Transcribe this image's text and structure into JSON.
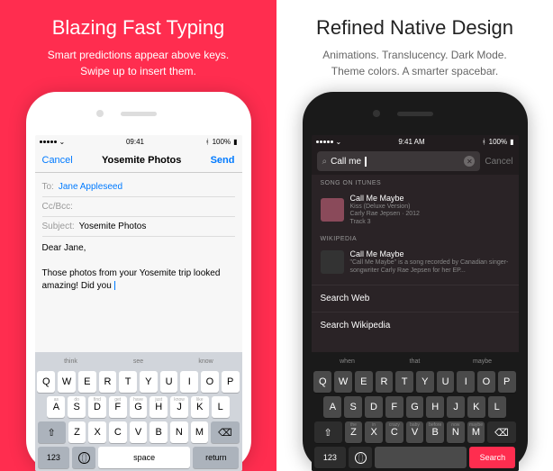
{
  "left": {
    "headline": "Blazing Fast Typing",
    "sub1": "Smart predictions appear above keys.",
    "sub2": "Swipe up to insert them.",
    "statusbar": {
      "carrier": "",
      "time": "09:41",
      "battery": "100%"
    },
    "nav": {
      "cancel": "Cancel",
      "title": "Yosemite Photos",
      "send": "Send"
    },
    "compose": {
      "to_label": "To:",
      "to_value": "Jane Appleseed",
      "cc_label": "Cc/Bcc:",
      "subject_label": "Subject:",
      "subject_value": "Yosemite Photos",
      "greeting": "Dear Jane,",
      "body": "Those photos from your Yosemite trip looked amazing! Did you "
    },
    "predictions": [
      "think",
      "see",
      "know"
    ],
    "hints_row2": [
      "as",
      "do",
      "find",
      "get",
      "have",
      "just",
      "know",
      "like"
    ],
    "keys": {
      "row1": [
        "Q",
        "W",
        "E",
        "R",
        "T",
        "Y",
        "U",
        "I",
        "O",
        "P"
      ],
      "row2": [
        "A",
        "S",
        "D",
        "F",
        "G",
        "H",
        "J",
        "K",
        "L"
      ],
      "row3": [
        "Z",
        "X",
        "C",
        "V",
        "B",
        "N",
        "M"
      ],
      "shift": "⇧",
      "backspace": "⌫",
      "numbers": "123",
      "space": "space",
      "return": "return"
    }
  },
  "right": {
    "headline": "Refined Native Design",
    "sub1": "Animations. Translucency. Dark Mode.",
    "sub2": "Theme colors. A smarter spacebar.",
    "statusbar": {
      "time": "9:41 AM",
      "battery": "100%"
    },
    "search": {
      "query": "Call me ",
      "cancel": "Cancel"
    },
    "sections": {
      "itunes": {
        "header": "SONG ON ITUNES",
        "title": "Call Me Maybe",
        "sub": "Kiss (Deluxe Version)\nCarly Rae Jepsen · 2012\nTrack 3"
      },
      "wiki": {
        "header": "WIKIPEDIA",
        "title": "Call Me Maybe",
        "sub": "\"Call Me Maybe\" is a song recorded by Canadian singer-songwriter Carly Rae Jepsen for her EP..."
      },
      "web": "Search Web",
      "wikipedia": "Search Wikipedia"
    },
    "predictions": [
      "when",
      "that",
      "maybe"
    ],
    "hints_row3": [
      "the",
      "in",
      "crazy",
      "baby",
      "before",
      "now",
      "maybe"
    ],
    "keys": {
      "row1": [
        "Q",
        "W",
        "E",
        "R",
        "T",
        "Y",
        "U",
        "I",
        "O",
        "P"
      ],
      "row2": [
        "A",
        "S",
        "D",
        "F",
        "G",
        "H",
        "J",
        "K",
        "L"
      ],
      "row3": [
        "Z",
        "X",
        "C",
        "V",
        "B",
        "N",
        "M"
      ],
      "shift": "⇧",
      "backspace": "⌫",
      "numbers": "123",
      "space": "",
      "search": "Search"
    }
  }
}
